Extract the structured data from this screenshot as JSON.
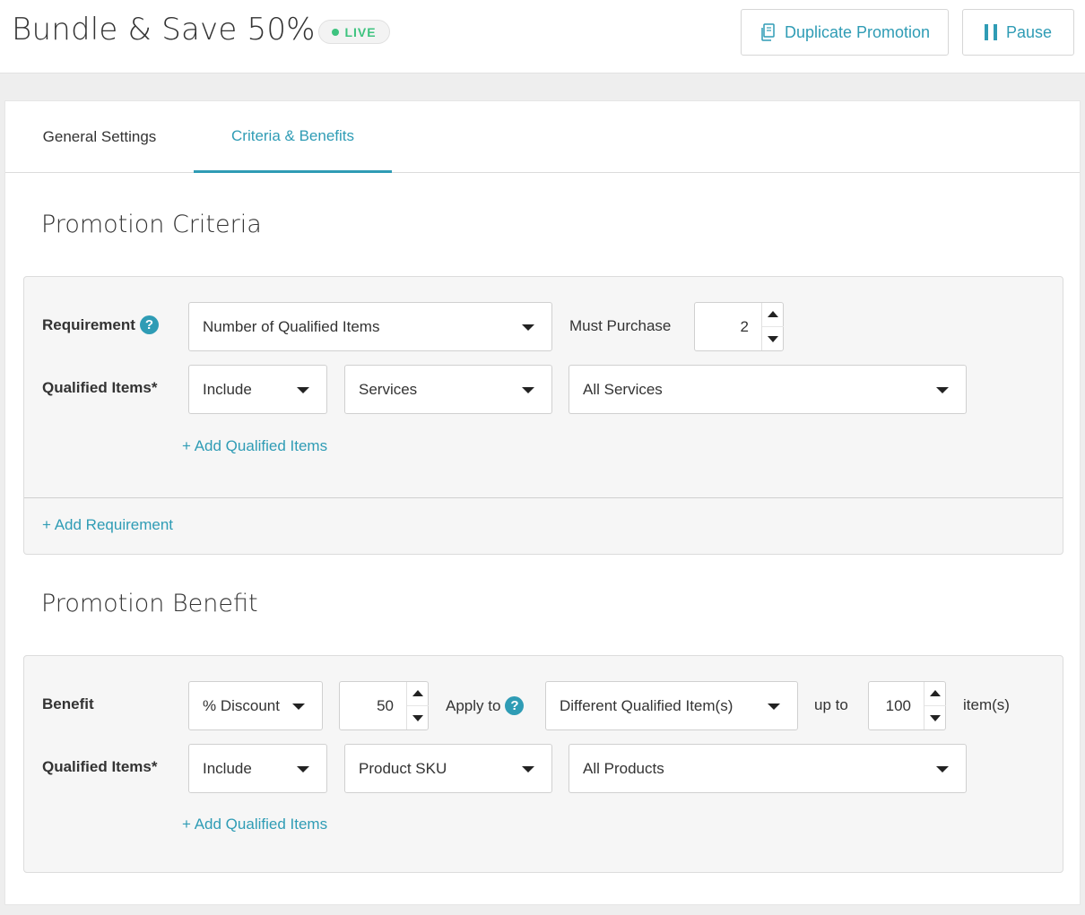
{
  "header": {
    "title": "Bundle & Save 50%",
    "status": "LIVE",
    "duplicate_label": "Duplicate Promotion",
    "pause_label": "Pause"
  },
  "tabs": [
    {
      "label": "General Settings",
      "active": false
    },
    {
      "label": "Criteria & Benefits",
      "active": true
    }
  ],
  "criteria": {
    "title": "Promotion Criteria",
    "requirement_label": "Requirement",
    "requirement_value": "Number of Qualified Items",
    "must_purchase_label": "Must Purchase",
    "must_purchase_value": "2",
    "qualified_label": "Qualified Items*",
    "qualified_mode": "Include",
    "qualified_type": "Services",
    "qualified_scope": "All Services",
    "add_qualified": "+ Add Qualified Items",
    "add_requirement": "+ Add Requirement"
  },
  "benefit": {
    "title": "Promotion Benefit",
    "benefit_label": "Benefit",
    "benefit_type": "% Discount",
    "benefit_amount": "50",
    "apply_to_label": "Apply to",
    "apply_to_value": "Different Qualified Item(s)",
    "up_to_label": "up to",
    "up_to_value": "100",
    "items_suffix": "item(s)",
    "qualified_label": "Qualified Items*",
    "qualified_mode": "Include",
    "qualified_type": "Product SKU",
    "qualified_scope": "All Products",
    "add_qualified": "+ Add Qualified Items"
  },
  "colors": {
    "accent": "#2f9cb5",
    "live_green": "#3ec37f",
    "panel_bg": "#f6f6f6"
  }
}
